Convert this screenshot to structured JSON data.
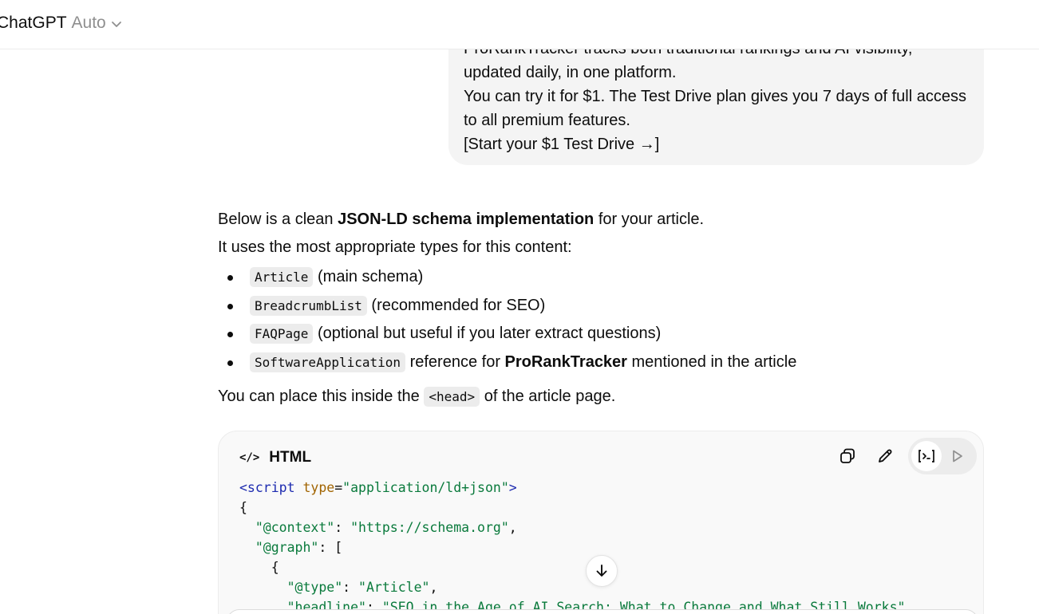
{
  "header": {
    "model_name": "ChatGPT",
    "model_mode": "Auto"
  },
  "user_message": {
    "lines": [
      "ProRankTracker tracks both traditional rankings and AI visibility,",
      "updated daily, in one platform.",
      "You can try it for $1. The Test Drive plan gives you 7 days of full access",
      "to all premium features.",
      "[Start your $1 Test Drive →]"
    ]
  },
  "assistant": {
    "intro_before": "Below is a clean ",
    "intro_bold": "JSON-LD schema implementation",
    "intro_after": " for your article.",
    "types_line": "It uses the most appropriate types for this content:",
    "bullets": [
      {
        "code": "Article",
        "text": " (main schema)"
      },
      {
        "code": "BreadcrumbList",
        "text": " (recommended for SEO)"
      },
      {
        "code": "FAQPage",
        "text": " (optional but useful if you later extract questions)"
      },
      {
        "code": "SoftwareApplication",
        "text": " reference for ",
        "bold": "ProRankTracker",
        "tail": " mentioned in the article"
      }
    ],
    "place_before": "You can place this inside the ",
    "place_code": "<head>",
    "place_after": " of the article page."
  },
  "codeblock": {
    "language": "HTML",
    "lang_icon": "</>",
    "lines": {
      "l1_open": "<script",
      "l1_attr": "type",
      "l1_eq": "=",
      "l1_val": "\"application/ld+json\"",
      "l1_close": ">",
      "l2": "{",
      "l3_key": "\"@context\"",
      "l3_sep": ": ",
      "l3_val": "\"https://schema.org\"",
      "l3_end": ",",
      "l4_key": "\"@graph\"",
      "l4_rest": ": [",
      "l5": "{",
      "l6_key": "\"@type\"",
      "l6_sep": ": ",
      "l6_val": "\"Article\"",
      "l6_end": ",",
      "l7_key": "\"headline\"",
      "l7_sep": ": ",
      "l7_val": "\"SEO in the Age of AI Search: What to Change and What Still Works\"",
      "l7_end": ","
    }
  },
  "icons": {
    "copy": "copy-icon",
    "edit": "edit-icon",
    "code_view": "code-view-icon",
    "run": "run-icon",
    "scroll_down": "arrow-down-icon",
    "chevron": "chevron-down-icon"
  },
  "colors": {
    "bubble_bg": "#f4f4f4",
    "code_bg": "#f9f9f9",
    "tag": "#1d2bb0",
    "attr": "#a16400",
    "string": "#0a7a3c"
  }
}
